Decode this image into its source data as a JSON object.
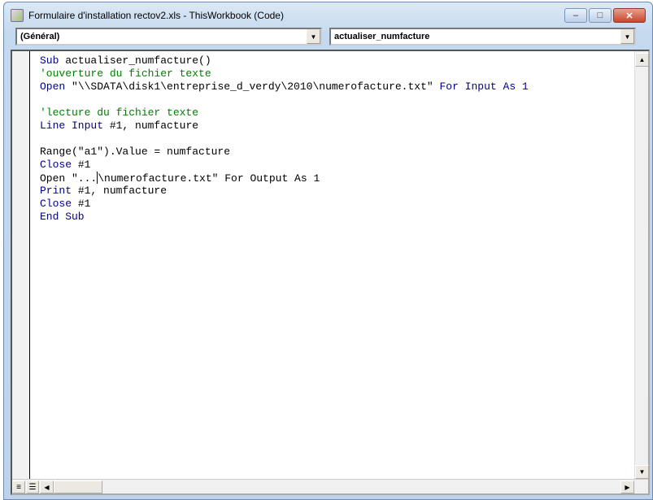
{
  "window": {
    "title": "Formulaire d'installation rectov2.xls - ThisWorkbook (Code)",
    "minimize": "–",
    "maximize": "□",
    "close": "✕"
  },
  "combos": {
    "object": "(Général)",
    "procedure": "actualiser_numfacture"
  },
  "code": [
    [
      {
        "t": "Sub ",
        "k": "kw"
      },
      {
        "t": "actualiser_numfacture()",
        "k": ""
      }
    ],
    [
      {
        "t": "'ouverture du fichier texte",
        "k": "cm"
      }
    ],
    [
      {
        "t": "Open ",
        "k": "kw"
      },
      {
        "t": "\"\\\\SDATA\\disk1\\entreprise_d_verdy\\2010\\numerofacture.txt\" ",
        "k": ""
      },
      {
        "t": "For Input As ",
        "k": "kw"
      },
      {
        "t": "1",
        "k": "kw"
      }
    ],
    [],
    [
      {
        "t": "'lecture du fichier texte",
        "k": "cm"
      }
    ],
    [
      {
        "t": "Line Input ",
        "k": "kw"
      },
      {
        "t": "#1, numfacture",
        "k": ""
      }
    ],
    [],
    [
      {
        "t": "Range(\"a1\").Value = numfacture",
        "k": ""
      }
    ],
    [
      {
        "t": "Close ",
        "k": "kw"
      },
      {
        "t": "#1",
        "k": ""
      }
    ],
    [
      {
        "t": "Open \"...",
        "k": ""
      },
      {
        "t": "\\numerofacture.txt\" For Output As 1",
        "k": "caret"
      }
    ],
    [
      {
        "t": "Print ",
        "k": "kw"
      },
      {
        "t": "#1, numfacture",
        "k": ""
      }
    ],
    [
      {
        "t": "Close ",
        "k": "kw"
      },
      {
        "t": "#1",
        "k": ""
      }
    ],
    [
      {
        "t": "End Sub",
        "k": "kw"
      }
    ]
  ]
}
